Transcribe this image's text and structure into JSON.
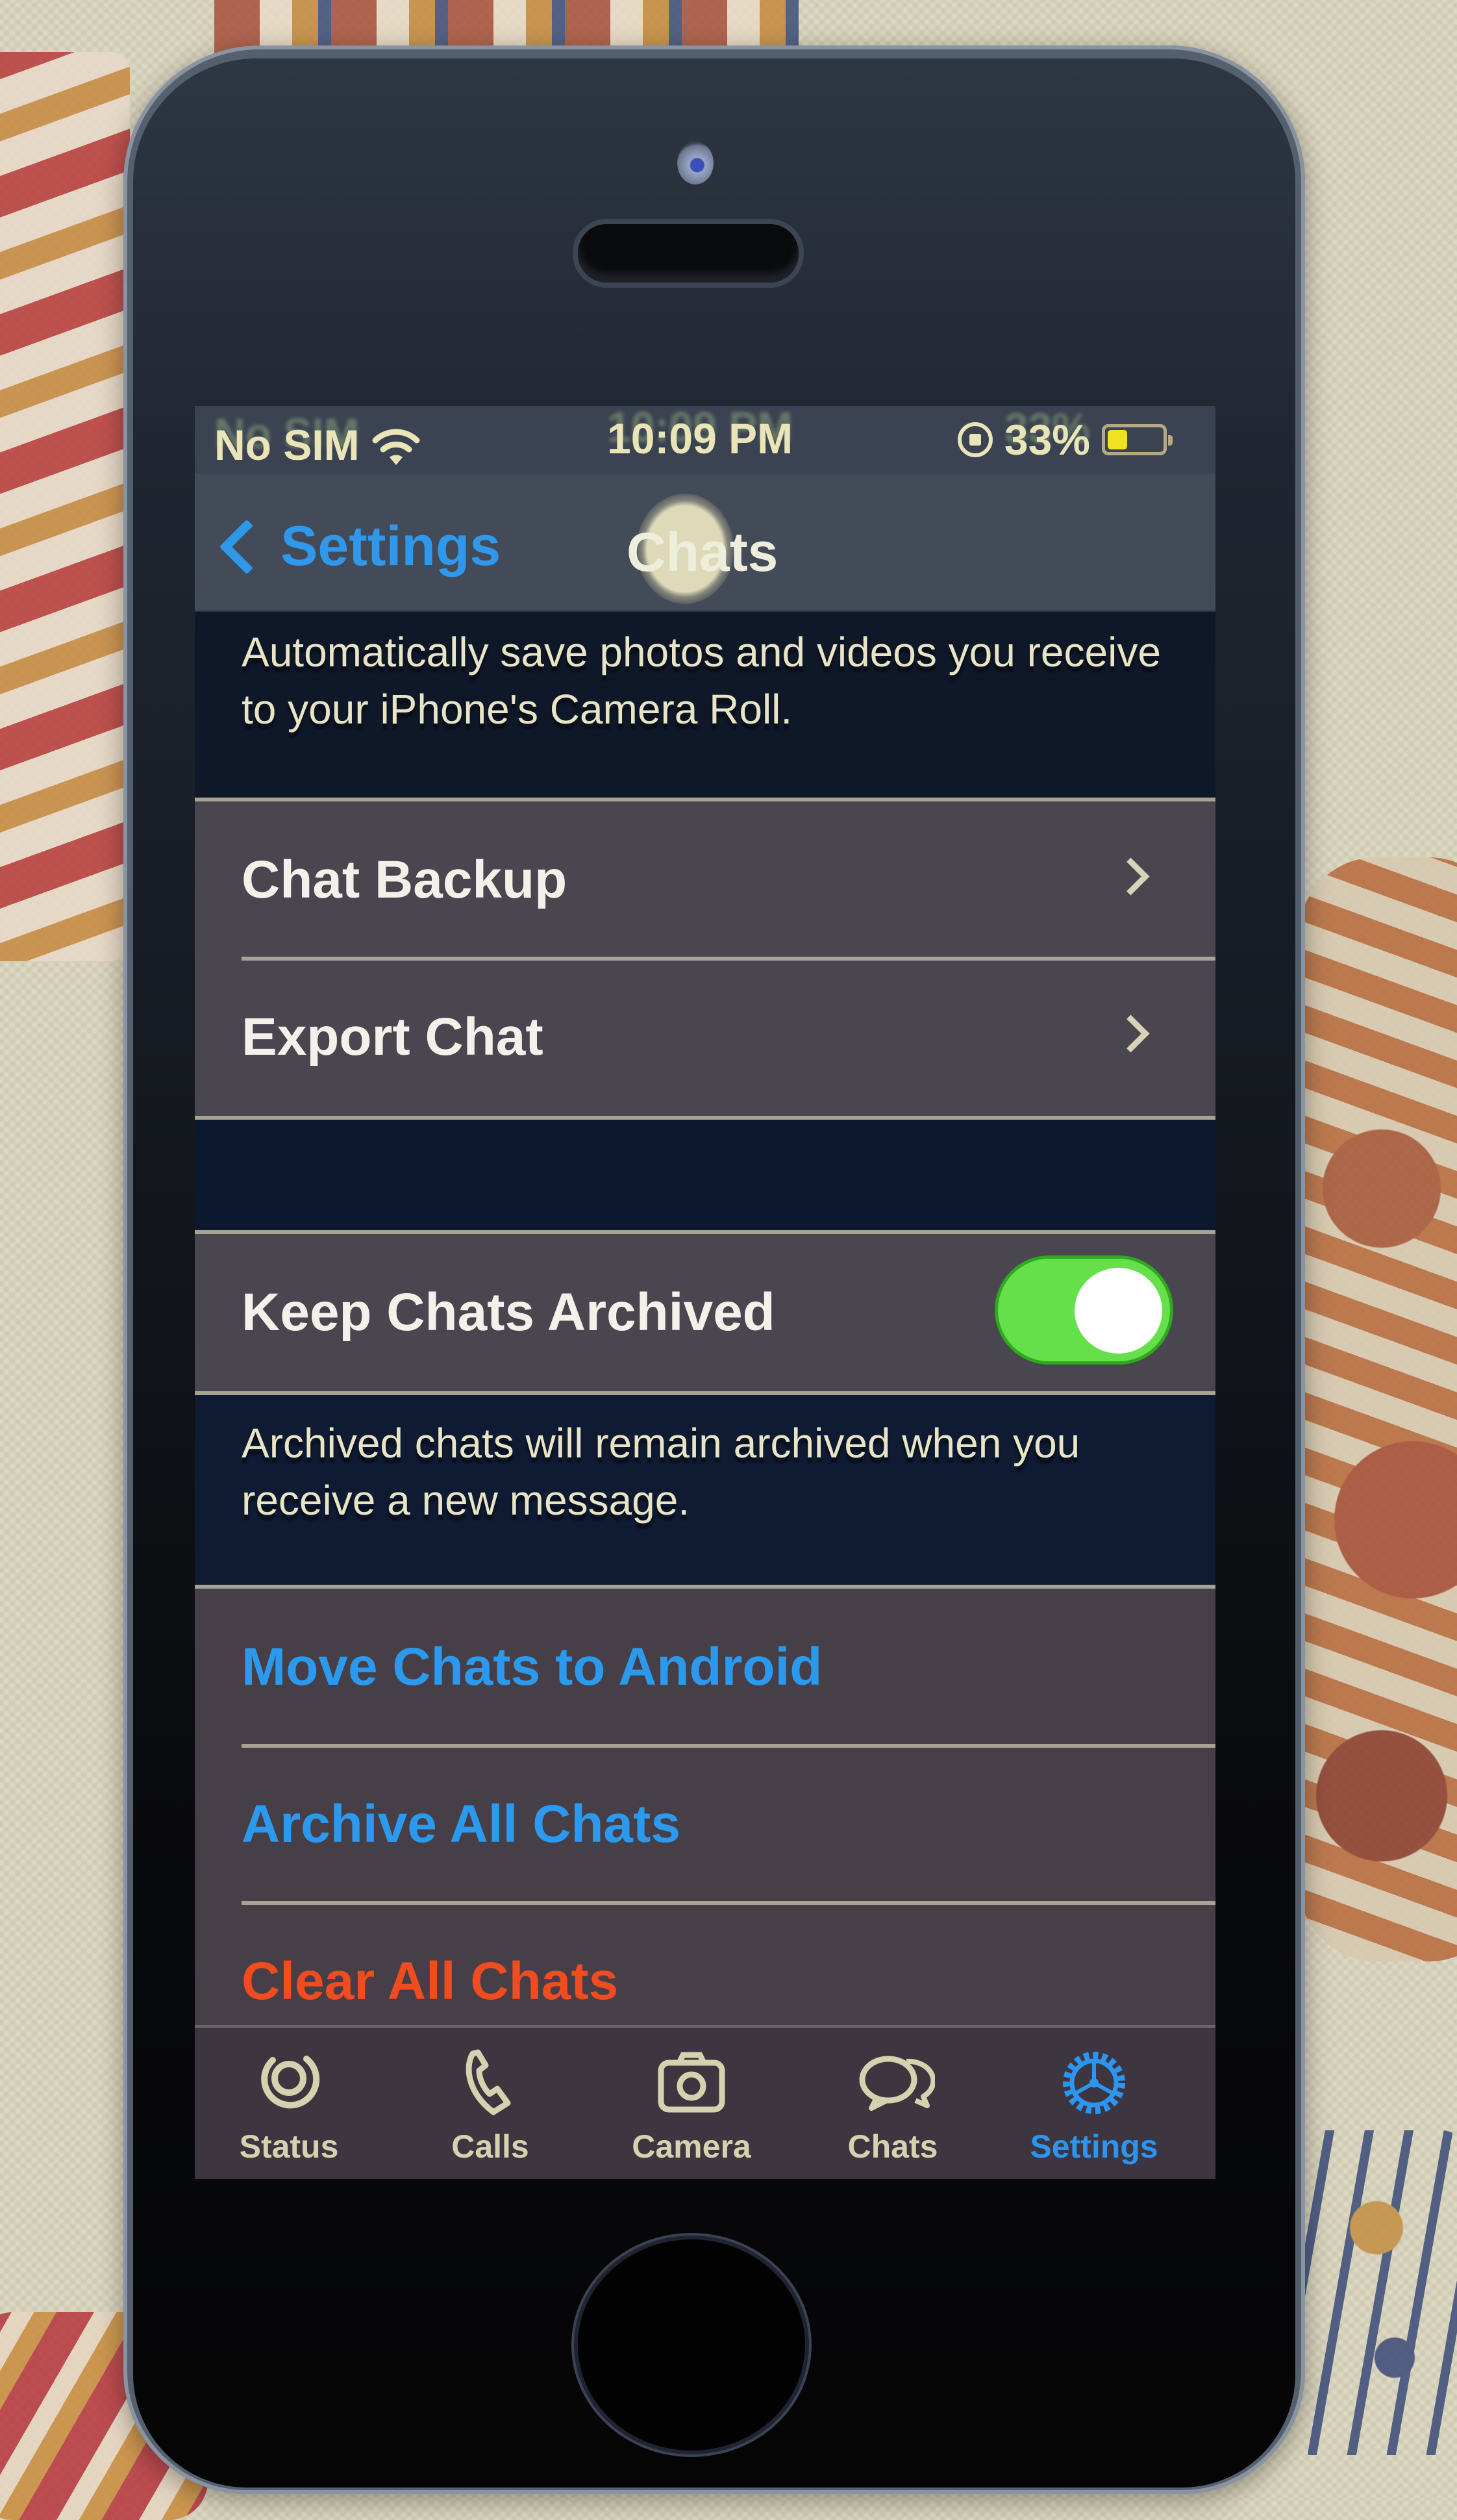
{
  "status_bar": {
    "carrier": "No SIM",
    "wifi_icon": "wifi-icon",
    "time": "10:09 PM",
    "rotation_lock_icon": "rotation-lock-icon",
    "battery_percent_label": "33%",
    "battery_level": 0.33
  },
  "nav": {
    "back_label": "Settings",
    "title": "Chats"
  },
  "save_to_camera_roll_footer": "Automatically save photos and videos you receive to your iPhone's Camera Roll.",
  "backup_section": {
    "rows": [
      {
        "label": "Chat Backup"
      },
      {
        "label": "Export Chat"
      }
    ]
  },
  "archive_section": {
    "row": {
      "label": "Keep Chats Archived",
      "toggle_on": true
    },
    "footer": "Archived chats will remain archived when you receive a new message."
  },
  "actions_section": {
    "rows": [
      {
        "label": "Move Chats to Android",
        "style": "blue"
      },
      {
        "label": "Archive All Chats",
        "style": "blue"
      },
      {
        "label": "Clear All Chats",
        "style": "destructive"
      }
    ]
  },
  "tab_bar": {
    "tabs": [
      {
        "label": "Status",
        "icon": "status-icon",
        "active": false
      },
      {
        "label": "Calls",
        "icon": "phone-icon",
        "active": false
      },
      {
        "label": "Camera",
        "icon": "camera-icon",
        "active": false
      },
      {
        "label": "Chats",
        "icon": "chat-bubbles-icon",
        "active": false
      },
      {
        "label": "Settings",
        "icon": "gear-icon",
        "active": true
      }
    ]
  },
  "colors": {
    "accent_blue": "#2b9aee",
    "destructive_red": "#f14b20",
    "toggle_green": "#66e04a"
  }
}
